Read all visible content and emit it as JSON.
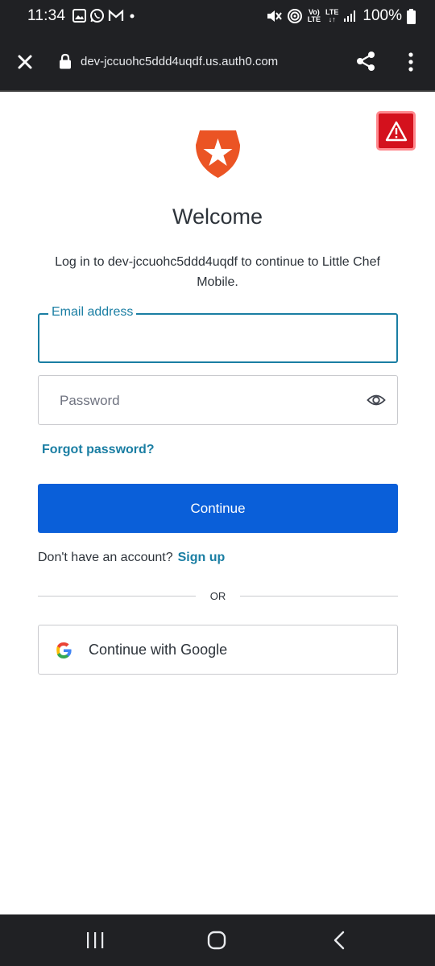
{
  "status_bar": {
    "time": "11:34",
    "left_icons": [
      "image-icon",
      "whatsapp-icon",
      "gmail-icon",
      "dot-icon"
    ],
    "battery": "100%",
    "lte_top": "LTE",
    "lte_bottom": "↓↑",
    "volte_top": "Vo)",
    "volte_bottom": "LTE"
  },
  "browser": {
    "url": "dev-jccuohc5ddd4uqdf.us.auth0.com",
    "icons": [
      "close-icon",
      "lock-icon",
      "share-icon",
      "more-vert-icon"
    ]
  },
  "warning_badge": {
    "icon": "warning-triangle-icon",
    "color": "#d4111d"
  },
  "login": {
    "title": "Welcome",
    "subtitle": "Log in to dev-jccuohc5ddd4uqdf to continue to Little Chef Mobile.",
    "email_label": "Email address",
    "email_value": "",
    "password_placeholder": "Password",
    "forgot_password": "Forgot password?",
    "continue_label": "Continue",
    "signup_prompt": "Don't have an account?",
    "signup_link": "Sign up",
    "divider_text": "OR",
    "google_label": "Continue with Google"
  },
  "colors": {
    "accent": "#1a7ea3",
    "primary_button": "#0a5fd9",
    "logo": "#eb5424"
  },
  "nav_bar": {
    "icons": [
      "recents-icon",
      "home-icon",
      "back-icon"
    ]
  }
}
